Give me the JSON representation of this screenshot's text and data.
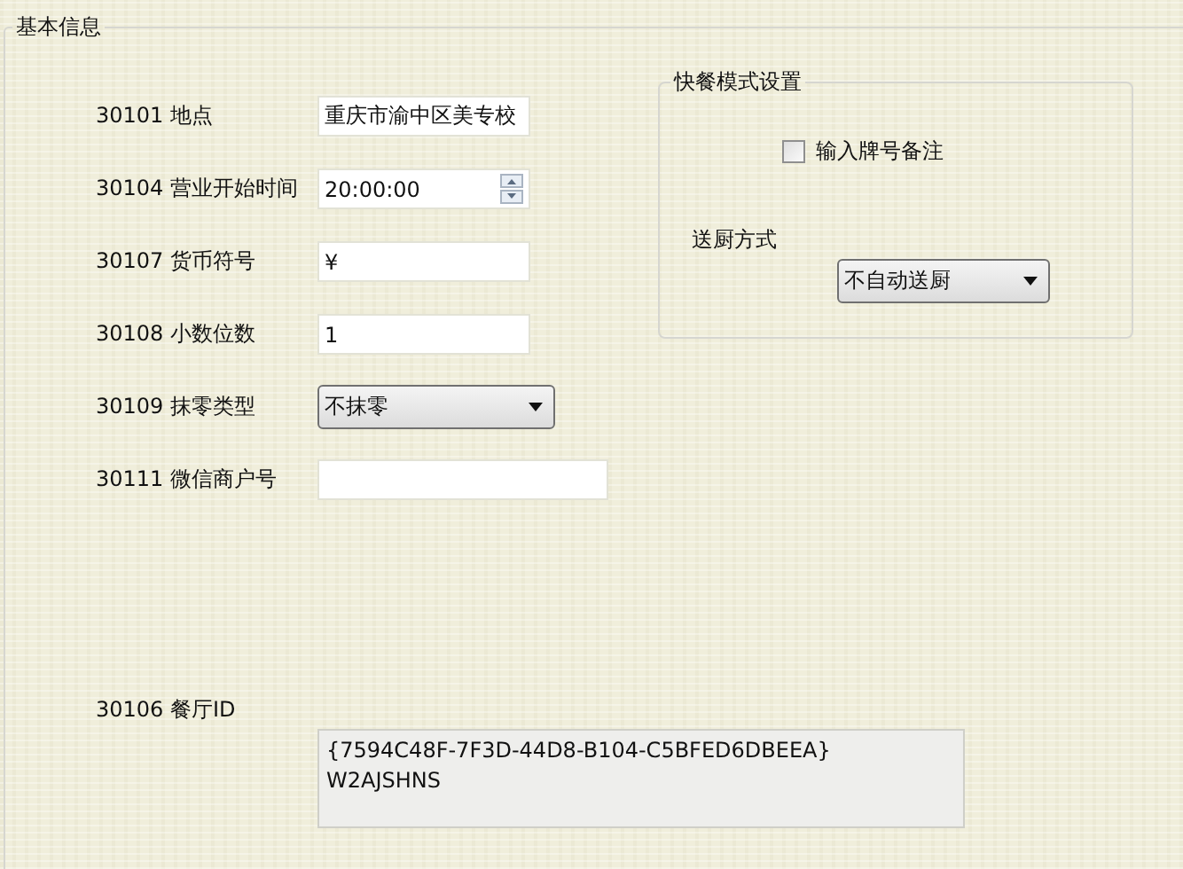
{
  "group": {
    "title": "基本信息"
  },
  "fields": [
    {
      "label": "30101 地点",
      "kind": "text",
      "value": "重庆市渝中区美专校"
    },
    {
      "label": "30104 营业开始时间",
      "kind": "spinner",
      "value": "20:00:00"
    },
    {
      "label": "30107 货币符号",
      "kind": "text",
      "value": "¥"
    },
    {
      "label": "30108 小数位数",
      "kind": "text",
      "value": "1"
    },
    {
      "label": "30109 抹零类型",
      "kind": "select",
      "value": "不抹零"
    },
    {
      "label": "30111 微信商户号",
      "kind": "wide"
    }
  ],
  "fast_mode": {
    "title": "快餐模式设置",
    "checkbox": {
      "label": "输入牌号备注",
      "checked": false
    },
    "send_label": "送厨方式",
    "send_select": {
      "value": "不自动送厨"
    }
  },
  "restaurant_id": {
    "label": "30106 餐厅ID",
    "lines": [
      "{7594C48F-7F3D-44D8-B104-C5BFED6DBEEA}",
      "W2AJSHNS"
    ]
  }
}
